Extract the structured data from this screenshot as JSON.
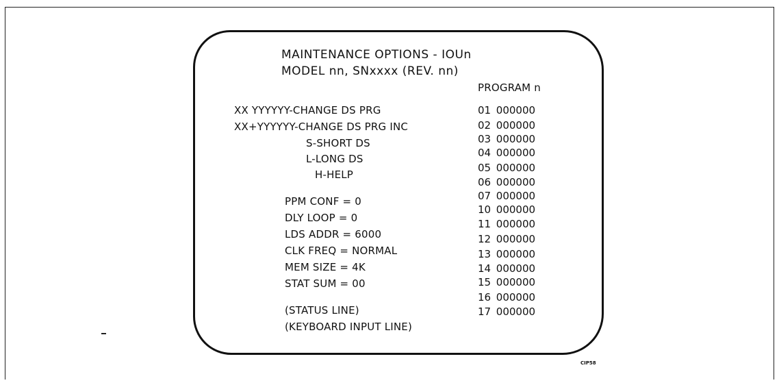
{
  "screen": {
    "title": "MAINTENANCE OPTIONS - IOUn",
    "model_line": "MODEL nn, SNxxxx (REV. nn)",
    "program_header": "PROGRAM n",
    "commands": [
      "XX YYYYYY-CHANGE DS PRG",
      "XX+YYYYYY-CHANGE DS PRG INC",
      "S-SHORT DS",
      "L-LONG DS",
      "H-HELP"
    ],
    "settings": [
      "PPM CONF = 0",
      "DLY LOOP = 0",
      "LDS ADDR = 6000",
      "CLK FREQ = NORMAL",
      "MEM SIZE = 4K",
      "STAT SUM = 00"
    ],
    "status_line": "(STATUS LINE)",
    "keyboard_line": "(KEYBOARD INPUT LINE)",
    "program_rows": [
      {
        "addr": "01",
        "value": "000000"
      },
      {
        "addr": "02",
        "value": "000000"
      },
      {
        "addr": "03",
        "value": "000000"
      },
      {
        "addr": "04",
        "value": "000000"
      },
      {
        "addr": "05",
        "value": "000000"
      },
      {
        "addr": "06",
        "value": "000000"
      },
      {
        "addr": "07",
        "value": "000000"
      },
      {
        "addr": "10",
        "value": "000000"
      },
      {
        "addr": "11",
        "value": "000000"
      },
      {
        "addr": "12",
        "value": "000000"
      },
      {
        "addr": "13",
        "value": "000000"
      },
      {
        "addr": "14",
        "value": "000000"
      },
      {
        "addr": "15",
        "value": "000000"
      },
      {
        "addr": "16",
        "value": "000000"
      },
      {
        "addr": "17",
        "value": "000000"
      }
    ]
  },
  "figure_code": "CIP58"
}
